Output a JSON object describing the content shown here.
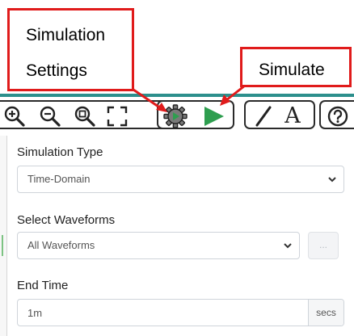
{
  "annotations": {
    "settings_line1": "Simulation",
    "settings_line2": "Settings",
    "simulate": "Simulate"
  },
  "toolbar": {
    "buttons": [
      {
        "icon": "zoom-in-icon"
      },
      {
        "icon": "zoom-out-icon"
      },
      {
        "icon": "zoom-fit-icon"
      },
      {
        "icon": "fullscreen-icon"
      },
      {
        "icon": "gear-icon"
      },
      {
        "icon": "play-icon"
      },
      {
        "icon": "draw-line-icon"
      },
      {
        "icon": "text-icon",
        "glyph": "A"
      },
      {
        "icon": "help-icon"
      }
    ],
    "accent_color": "#2c8f8c",
    "play_color": "#2e9e4f"
  },
  "panel": {
    "simulation_type": {
      "label": "Simulation Type",
      "value": "Time-Domain"
    },
    "select_waveforms": {
      "label": "Select Waveforms",
      "value": "All Waveforms",
      "more_button": "..."
    },
    "end_time": {
      "label": "End Time",
      "value": "1m",
      "unit": "secs"
    }
  }
}
